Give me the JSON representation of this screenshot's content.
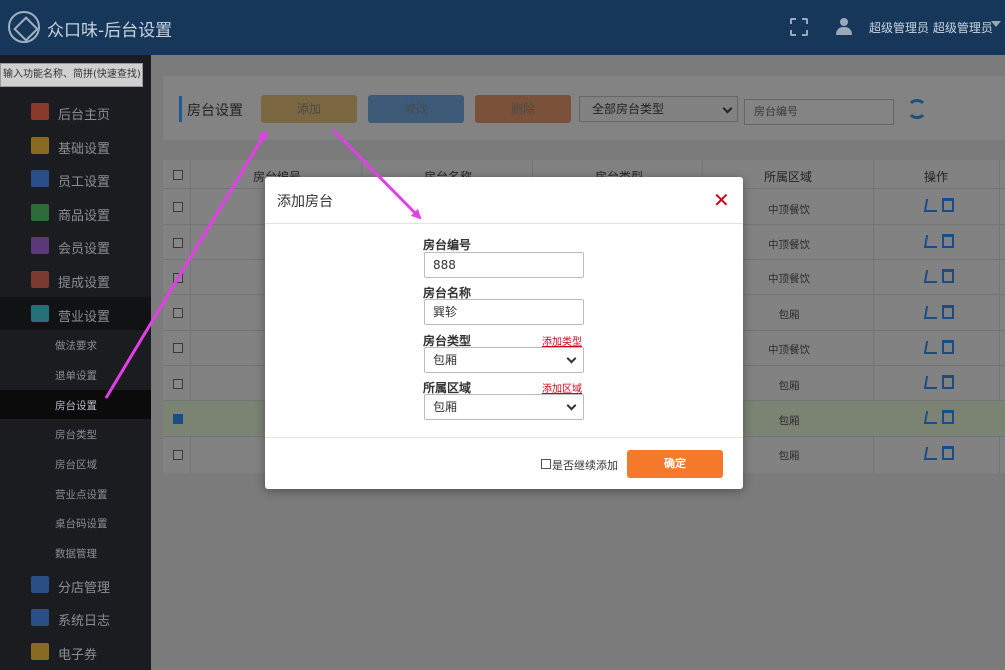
{
  "header": {
    "title": "众口味-后台设置",
    "user": "超级管理员 超级管理员"
  },
  "sidebar": {
    "search_placeholder": "输入功能名称、简拼(快速查找)",
    "items": [
      {
        "label": "后台主页",
        "icon": "home-icon",
        "color": "#8a3a2a"
      },
      {
        "label": "基础设置",
        "icon": "puzzle-icon",
        "color": "#8a6a22"
      },
      {
        "label": "员工设置",
        "icon": "staff-icon",
        "color": "#2a4f86"
      },
      {
        "label": "商品设置",
        "icon": "basket-icon",
        "color": "#2f6a3a"
      },
      {
        "label": "会员设置",
        "icon": "crown-icon",
        "color": "#5a3a7a"
      },
      {
        "label": "提成设置",
        "icon": "chart-icon",
        "color": "#7a3a2f"
      },
      {
        "label": "营业设置",
        "icon": "store-icon",
        "color": "#26707a"
      }
    ],
    "sub_items": [
      {
        "label": "做法要求"
      },
      {
        "label": "退单设置"
      },
      {
        "label": "房台设置"
      },
      {
        "label": "房台类型"
      },
      {
        "label": "房台区域"
      },
      {
        "label": "营业点设置"
      },
      {
        "label": "桌台码设置"
      },
      {
        "label": "数据管理"
      }
    ],
    "items_after": [
      {
        "label": "分店管理",
        "icon": "branch-icon",
        "color": "#2a4f86"
      },
      {
        "label": "系统日志",
        "icon": "log-icon",
        "color": "#2a4f86"
      },
      {
        "label": "电子券",
        "icon": "coupon-icon",
        "color": "#8a6a22"
      }
    ]
  },
  "toolbar": {
    "title": "房台设置",
    "add_label": "添加",
    "edit_label": "修改",
    "delete_label": "删除",
    "type_select": "全部房台类型",
    "room_no_placeholder": "房台编号"
  },
  "table": {
    "headers": [
      "房台编号",
      "房台名称",
      "房台类型",
      "所属区域",
      "操作"
    ],
    "rows": [
      {
        "area": "中顶餐饮",
        "checked": false
      },
      {
        "area": "中顶餐饮",
        "checked": false
      },
      {
        "area": "中顶餐饮",
        "checked": false
      },
      {
        "area": "包厢",
        "checked": false
      },
      {
        "area": "中顶餐饮",
        "checked": false
      },
      {
        "area": "包厢",
        "checked": false
      },
      {
        "area": "包厢",
        "checked": true
      },
      {
        "area": "包厢",
        "checked": false
      }
    ]
  },
  "dialog": {
    "title": "添加房台",
    "room_no_label": "房台编号",
    "room_no_value": "888",
    "room_name_label": "房台名称",
    "room_name_value": "巽轸",
    "room_type_label": "房台类型",
    "add_type_link": "添加类型",
    "room_type_value": "包厢",
    "area_label": "所属区域",
    "add_area_link": "添加区域",
    "area_value": "包厢",
    "continue_label": "是否继续添加",
    "confirm_label": "确定"
  },
  "colors": {
    "accent_orange": "#f5792a",
    "close_red": "#d0021b",
    "annotation_magenta": "#e33ee8"
  }
}
